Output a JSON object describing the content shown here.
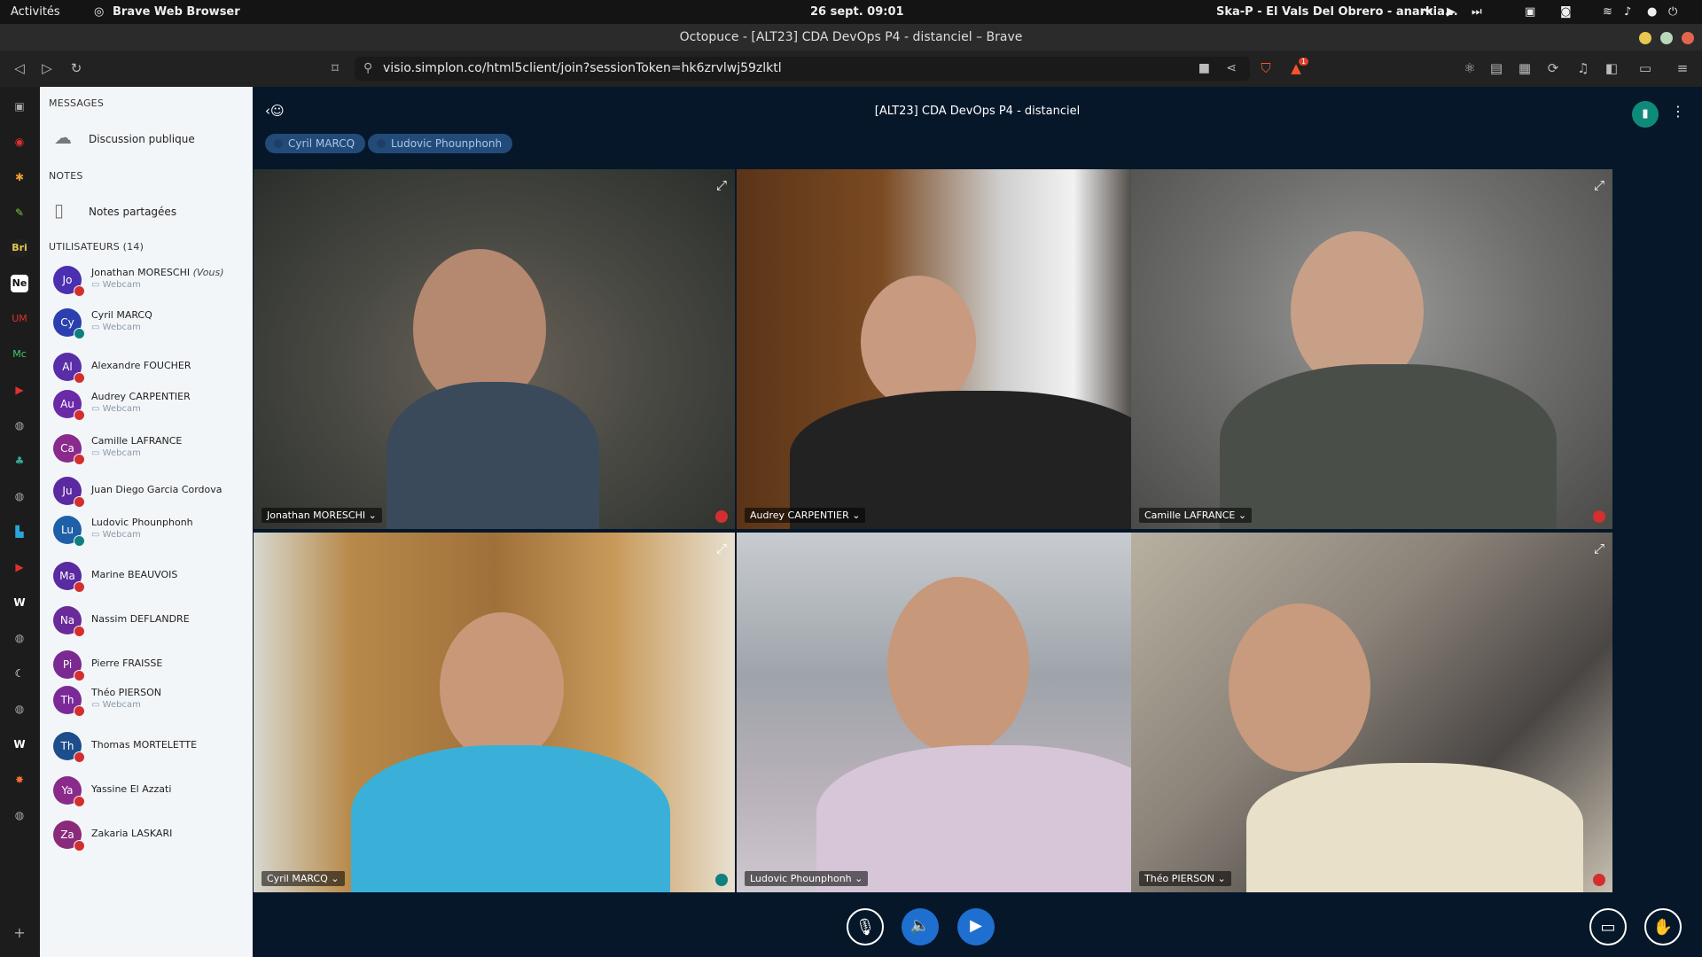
{
  "os_bar": {
    "activities": "Activités",
    "app_name": "Brave Web Browser",
    "clock": "26 sept.  09:01",
    "media_title": "Ska-P - El Vals Del Obrero - anarkia..."
  },
  "window": {
    "title": "Octopuce - [ALT23] CDA DevOps P4 - distanciel – Brave"
  },
  "browser": {
    "url": "visio.simplon.co/html5client/join?sessionToken=hk6zrvlwj59zlktl",
    "shield_badge": "1"
  },
  "brave_sidebar": [
    "Bri",
    "Ne",
    "UM",
    "Mc"
  ],
  "panel": {
    "messages_header": "MESSAGES",
    "public_chat": "Discussion publique",
    "notes_header": "NOTES",
    "shared_notes": "Notes partagées",
    "users_header": "UTILISATEURS (14)",
    "webcam_label": "Webcam",
    "you_label": "(Vous)",
    "users": [
      {
        "initials": "Jo",
        "name": "Jonathan MORESCHI",
        "you": true,
        "webcam": true,
        "muted": true,
        "color": "#4a2fb0"
      },
      {
        "initials": "Cy",
        "name": "Cyril MARCQ",
        "webcam": true,
        "muted": false,
        "color": "#2b3fae"
      },
      {
        "initials": "Al",
        "name": "Alexandre FOUCHER",
        "webcam": false,
        "muted": true,
        "color": "#5a2da8"
      },
      {
        "initials": "Au",
        "name": "Audrey CARPENTIER",
        "webcam": true,
        "muted": true,
        "color": "#6a2aa8"
      },
      {
        "initials": "Ca",
        "name": "Camille LAFRANCE",
        "webcam": true,
        "muted": true,
        "color": "#8a2a8c"
      },
      {
        "initials": "Ju",
        "name": "Juan Diego Garcia Cordova",
        "webcam": false,
        "muted": true,
        "color": "#5b2aa0"
      },
      {
        "initials": "Lu",
        "name": "Ludovic Phounphonh",
        "webcam": true,
        "muted": false,
        "color": "#1f5fa8"
      },
      {
        "initials": "Ma",
        "name": "Marine BEAUVOIS",
        "webcam": false,
        "muted": true,
        "color": "#5a2aa0"
      },
      {
        "initials": "Na",
        "name": "Nassim DEFLANDRE",
        "webcam": false,
        "muted": true,
        "color": "#6a2a9a"
      },
      {
        "initials": "Pi",
        "name": "Pierre FRAISSE",
        "webcam": false,
        "muted": true,
        "color": "#7a2a90"
      },
      {
        "initials": "Th",
        "name": "Théo PIERSON",
        "webcam": true,
        "muted": true,
        "color": "#7a2a98"
      },
      {
        "initials": "Th",
        "name": "Thomas MORTELETTE",
        "webcam": false,
        "muted": true,
        "color": "#1d4d8a"
      },
      {
        "initials": "Ya",
        "name": "Yassine El Azzati",
        "webcam": false,
        "muted": true,
        "color": "#8a2a8a"
      },
      {
        "initials": "Za",
        "name": "Zakaria LASKARI",
        "webcam": false,
        "muted": true,
        "color": "#8a2a7a"
      }
    ]
  },
  "meeting": {
    "title": "[ALT23] CDA DevOps P4 - distanciel",
    "talkers": [
      "Cyril MARCQ",
      "Ludovic Phounphonh"
    ],
    "tiles": [
      {
        "name": "Jonathan MORESCHI",
        "muted": true
      },
      {
        "name": "Audrey CARPENTIER",
        "muted": true
      },
      {
        "name": "Camille LAFRANCE",
        "muted": true
      },
      {
        "name": "Cyril MARCQ",
        "muted": false
      },
      {
        "name": "Ludovic Phounphonh",
        "muted": false
      },
      {
        "name": "Théo PIERSON",
        "muted": true
      }
    ]
  }
}
